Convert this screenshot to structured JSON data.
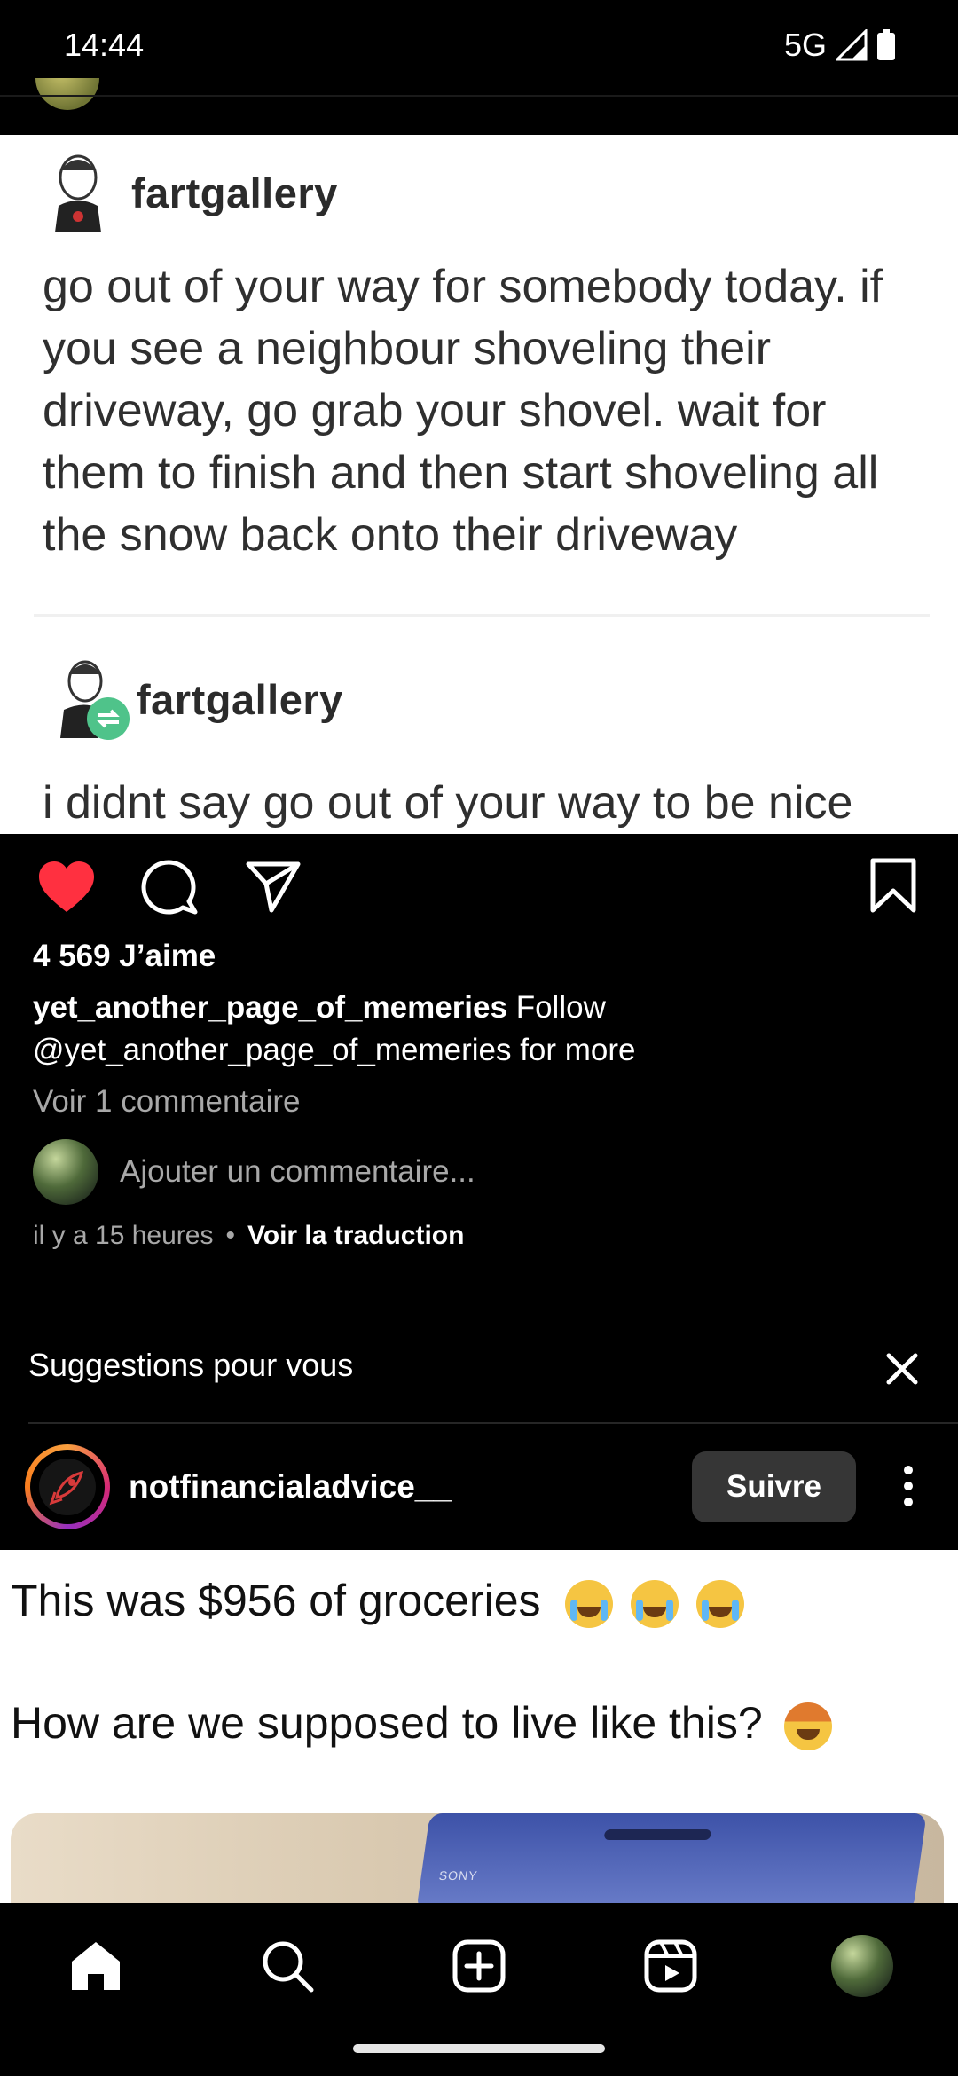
{
  "status_bar": {
    "time": "14:44",
    "network": "5G"
  },
  "post1": {
    "meme": {
      "username_1": "fartgallery",
      "text_lines": [
        "go out of your way for somebody today. if",
        "you see a neighbour shoveling their",
        "driveway, go grab your shovel. wait for",
        "them to finish and then start shoveling all",
        "the snow back onto their driveway"
      ],
      "username_2": "fartgallery",
      "reply_text": "i didnt say go out of your way to be nice"
    },
    "likes": "4 569 J’aime",
    "caption": {
      "author": "yet_another_page_of_memeries",
      "text_line1": "Follow",
      "text_line2": "@yet_another_page_of_memeries for more"
    },
    "view_comments": "Voir 1 commentaire",
    "comment_placeholder": "Ajouter un commentaire...",
    "time_ago": "il y a 15 heures",
    "translate": "Voir la traduction"
  },
  "suggestions": {
    "title": "Suggestions pour vous",
    "account": "notfinancialadvice__",
    "follow_label": "Suivre"
  },
  "post2": {
    "line1": "This was $956 of groceries",
    "line2": "How are we supposed to live like this?",
    "photo_text": "SONY"
  },
  "colors": {
    "like": "#ff3040",
    "follow_button": "#363636",
    "muted_text": "#a8a8a8"
  },
  "icons": [
    "heart-icon",
    "comment-icon",
    "share-icon",
    "bookmark-icon",
    "close-icon",
    "more-icon",
    "home-icon",
    "search-icon",
    "create-icon",
    "reels-icon"
  ]
}
